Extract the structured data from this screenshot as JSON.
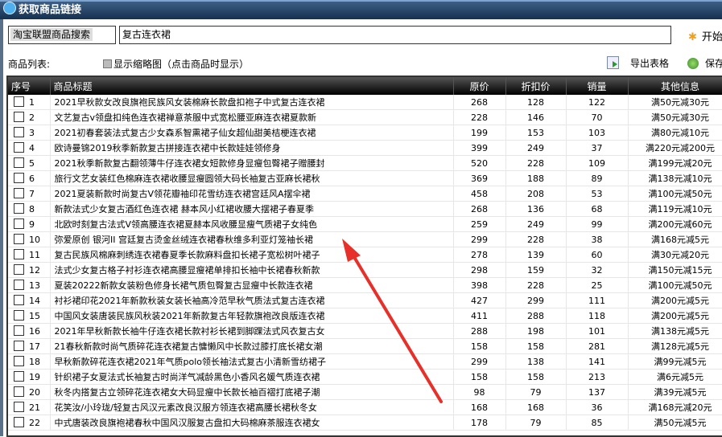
{
  "window": {
    "title": "获取商品链接"
  },
  "search": {
    "source": "淘宝联盟商品搜索",
    "keyword": "复古连衣裙",
    "start_label": "开始"
  },
  "toolbar": {
    "list_label": "商品列表:",
    "thumb_label": "显示缩略图（点击商品时显示）",
    "export_label": "导出表格",
    "save_label": "保存"
  },
  "table": {
    "columns": [
      "序号",
      "商品标题",
      "原价",
      "折扣价",
      "销量",
      "其他信息"
    ],
    "rows": [
      {
        "no": "1",
        "title": "2021早秋款女改良旗袍民族风女装棉麻长款盘扣袍子中式复古连衣裙",
        "price": "268",
        "discount": "128",
        "sales": "122",
        "info": "满50元减30元"
      },
      {
        "no": "2",
        "title": "文艺复古v领盘扣纯色连衣裙禅意茶服中式宽松腰亚麻连衣裙夏款新",
        "price": "228",
        "discount": "146",
        "sales": "70",
        "info": "满50元减30元"
      },
      {
        "no": "3",
        "title": "2021初春套装法式复古少女森系智熏裙子仙女超仙甜美桔梗连衣裙",
        "price": "199",
        "discount": "153",
        "sales": "103",
        "info": "满80元减10元"
      },
      {
        "no": "4",
        "title": "欧诗曼锦2019秋季新款复古拼接连衣裙中长款娃娃领修身",
        "price": "399",
        "discount": "249",
        "sales": "37",
        "info": "满220元减200元"
      },
      {
        "no": "5",
        "title": "2021秋季新款复古翻领薄牛仔连衣裙女短款修身显瘦包臀裙子赠腰封",
        "price": "520",
        "discount": "228",
        "sales": "109",
        "info": "满199元减20元"
      },
      {
        "no": "6",
        "title": "旅行文艺女装红色棉麻连衣裙收腰显瘦圆领大码长袖复古亚麻长裙秋",
        "price": "369",
        "discount": "188",
        "sales": "89",
        "info": "满138元减10元"
      },
      {
        "no": "7",
        "title": "2021夏装新款时尚复古V领花瓣袖印花雪纺连衣裙宫廷风A摆伞裙",
        "price": "458",
        "discount": "208",
        "sales": "53",
        "info": "满100元减50元"
      },
      {
        "no": "8",
        "title": "新款法式少女复古酒红色连衣裙 赫本风小红裙收腰大摆裙子春夏季",
        "price": "268",
        "discount": "136",
        "sales": "68",
        "info": "满119元减10元"
      },
      {
        "no": "9",
        "title": "北欧时刻复古法式V领高腰连衣裙夏赫本风收腰显瘦气质裙子女纯色",
        "price": "259",
        "discount": "249",
        "sales": "99",
        "info": "满200元减60元"
      },
      {
        "no": "10",
        "title": "弥爱原创 银河II 宫廷复古烫金丝绒连衣裙春秋维多利亚灯笼袖长裙",
        "price": "299",
        "discount": "228",
        "sales": "38",
        "info": "满168元减5元"
      },
      {
        "no": "11",
        "title": "复古民族风棉麻刺绣连衣裙春夏季长款麻料盘扣长裙子宽松树叶裙子",
        "price": "278",
        "discount": "139",
        "sales": "60",
        "info": "满30元减20元"
      },
      {
        "no": "12",
        "title": "法式少女复古格子衬衫连衣裙高腰显瘦裙单排扣长袖中长裙春秋新款",
        "price": "298",
        "discount": "159",
        "sales": "32",
        "info": "满150元减15元"
      },
      {
        "no": "13",
        "title": "夏装20222新款女装粉色修身长裙气质包臀复古显瘦中长款连衣裙",
        "price": "398",
        "discount": "228",
        "sales": "25",
        "info": "满100元减50元"
      },
      {
        "no": "14",
        "title": "衬衫裙印花2021年新款秋装女装长袖高冷范早秋气质法式复古连衣裙",
        "price": "427",
        "discount": "299",
        "sales": "111",
        "info": "满200元减5元"
      },
      {
        "no": "15",
        "title": "中国风女装唐装民族风秋装2021年新款复古年轻款旗袍改良版连衣裙",
        "price": "411",
        "discount": "288",
        "sales": "118",
        "info": "满200元减5元"
      },
      {
        "no": "16",
        "title": "2021年早秋新款长袖牛仔连衣裙长款衬衫长裙到脚踝法式风衣复古女",
        "price": "288",
        "discount": "198",
        "sales": "101",
        "info": "满138元减5元"
      },
      {
        "no": "17",
        "title": "21春秋新款时尚气质碎花连衣裙复古慵懒风中长款过膝打底长裙女潮",
        "price": "158",
        "discount": "158",
        "sales": "281",
        "info": "满128元减5元"
      },
      {
        "no": "18",
        "title": "早秋新款碎花连衣裙2021年气质polo领长袖法式复古小清新雪纺裙子",
        "price": "299",
        "discount": "138",
        "sales": "141",
        "info": "满99元减5元"
      },
      {
        "no": "19",
        "title": "针织裙子女夏法式长袖复古时尚洋气减龄黑色小香风名媛气质连衣裙",
        "price": "158",
        "discount": "158",
        "sales": "213",
        "info": "满6元减5元"
      },
      {
        "no": "20",
        "title": "秋冬内搭复古立领碎花连衣裙女大码显瘦中长款长袖百褶打底裙子潮",
        "price": "98",
        "discount": "79",
        "sales": "137",
        "info": "满39元减5元"
      },
      {
        "no": "21",
        "title": "花笑汝/小玲珑/轻复古风汉元素改良汉服方领连衣裙高腰长裙秋冬女",
        "price": "168",
        "discount": "168",
        "sales": "36",
        "info": "满168元减20元"
      },
      {
        "no": "22",
        "title": "中式唐装改良旗袍裙春秋中国风汉服复古盘扣大码棉麻茶服连衣裙女",
        "price": "178",
        "discount": "79",
        "sales": "85",
        "info": "满50元减5元"
      }
    ]
  },
  "colors": {
    "arrow": "#e8302a",
    "header": "#000000"
  }
}
